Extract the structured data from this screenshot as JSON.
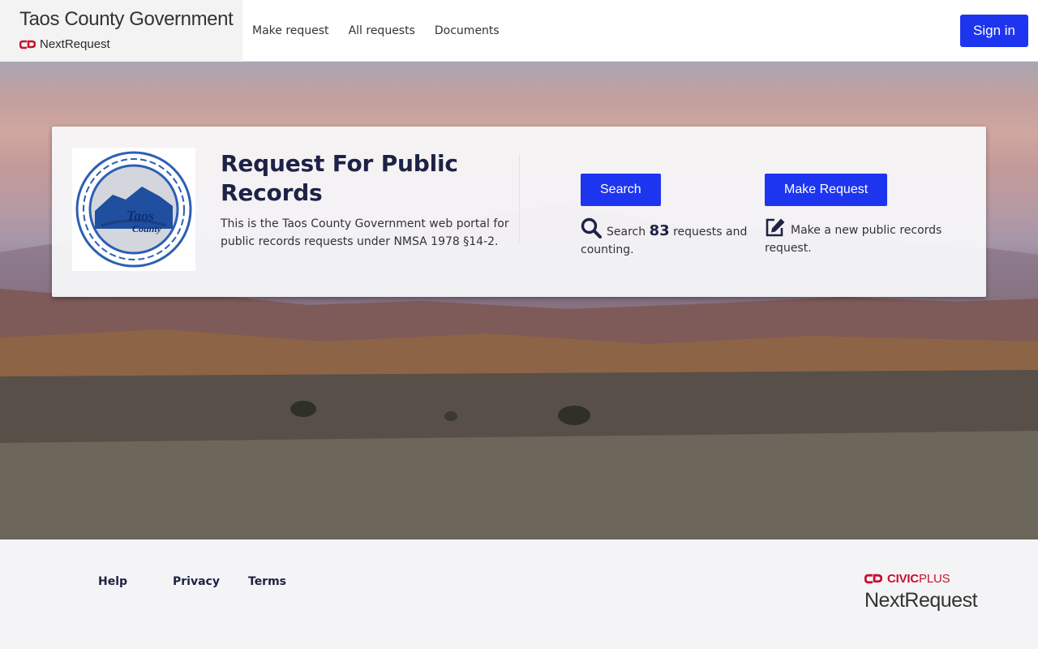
{
  "header": {
    "brand_title": "Taos County Government",
    "brand_sub": "NextRequest",
    "nav": [
      "Make request",
      "All requests",
      "Documents"
    ],
    "signin_label": "Sign in"
  },
  "card": {
    "title": "Request For Public Records",
    "description": "This is the Taos County Government web portal for public records requests under NMSA 1978 §14-2.",
    "logo_text": "Taos County",
    "search": {
      "button": "Search",
      "desc_prefix": "Search",
      "count": "83",
      "desc_suffix": "requests and counting."
    },
    "make": {
      "button": "Make Request",
      "desc": "Make a new public records request."
    }
  },
  "footer": {
    "links": [
      "Help",
      "Privacy",
      "Terms"
    ],
    "civic_bold": "CIVIC",
    "civic_normal": "PLUS",
    "nextrequest": "NextRequest"
  },
  "colors": {
    "accent": "#1e35f0",
    "brand_red": "#c8102e",
    "heading": "#1d2246"
  }
}
